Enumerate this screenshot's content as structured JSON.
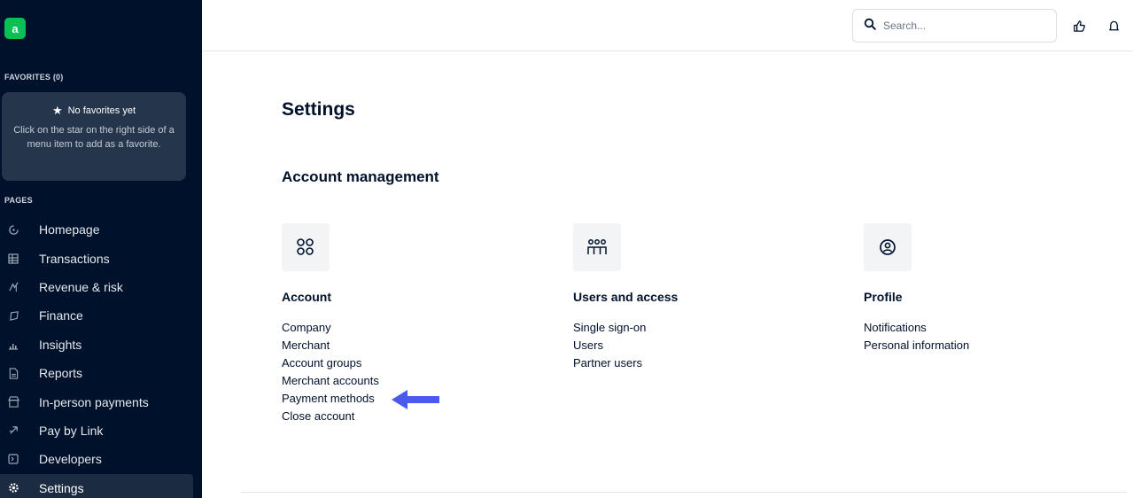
{
  "sidebar": {
    "logo": "a",
    "favorites_label": "FAVORITES (0)",
    "favorites_empty_title": "No favorites yet",
    "favorites_empty_desc": "Click on the star on the right side of a menu item to add as a favorite.",
    "pages_label": "PAGES",
    "items": [
      {
        "label": "Homepage",
        "icon": "home-icon"
      },
      {
        "label": "Transactions",
        "icon": "table-icon"
      },
      {
        "label": "Revenue & risk",
        "icon": "revenue-risk-icon"
      },
      {
        "label": "Finance",
        "icon": "finance-icon"
      },
      {
        "label": "Insights",
        "icon": "bar-chart-icon"
      },
      {
        "label": "Reports",
        "icon": "document-icon"
      },
      {
        "label": "In-person payments",
        "icon": "store-icon"
      },
      {
        "label": "Pay by Link",
        "icon": "rocket-icon"
      },
      {
        "label": "Developers",
        "icon": "terminal-icon"
      },
      {
        "label": "Settings",
        "icon": "gear-icon",
        "active": true
      }
    ]
  },
  "header": {
    "search_placeholder": "Search..."
  },
  "main": {
    "title": "Settings",
    "section_title": "Account management",
    "columns": [
      {
        "title": "Account",
        "icon": "apps-grid-icon",
        "links": [
          "Company",
          "Merchant",
          "Account groups",
          "Merchant accounts",
          "Payment methods",
          "Close account"
        ]
      },
      {
        "title": "Users and access",
        "icon": "users-group-icon",
        "links": [
          "Single sign-on",
          "Users",
          "Partner users"
        ]
      },
      {
        "title": "Profile",
        "icon": "profile-icon",
        "links": [
          "Notifications",
          "Personal information"
        ]
      }
    ]
  },
  "annotation": {
    "arrow_color": "#4a5af0",
    "points_to": "Payment methods"
  },
  "colors": {
    "sidebar_bg": "#00112c",
    "brand_green": "#0abf53",
    "text": "#00112c"
  }
}
